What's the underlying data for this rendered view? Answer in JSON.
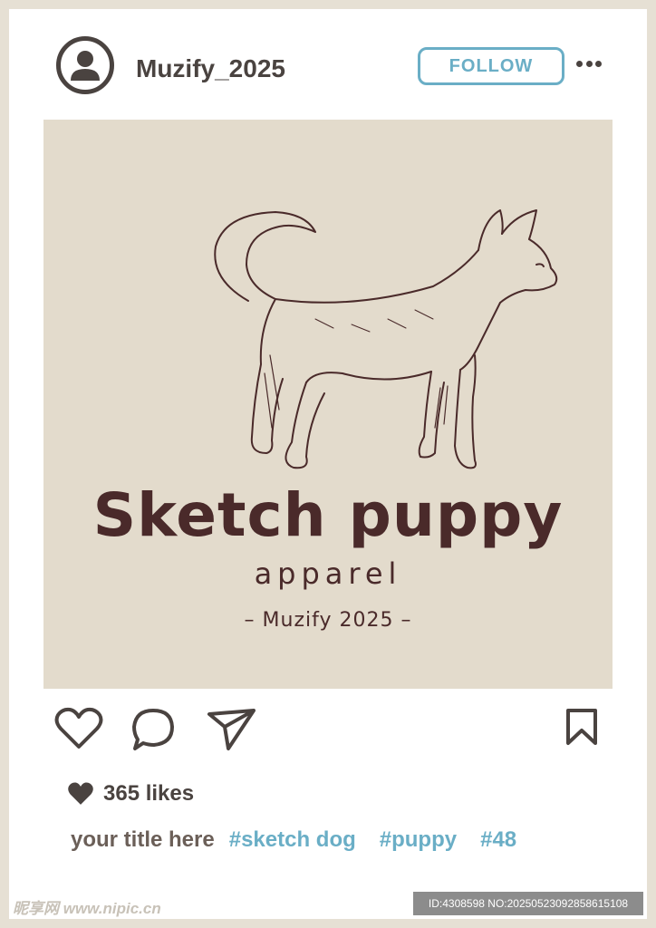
{
  "post": {
    "username": "Muzify_2025",
    "follow_label": "FOLLOW",
    "image": {
      "brand_title": "Sketch puppy",
      "brand_subtitle": "apparel",
      "brand_credit": "– Muzify 2025 –"
    },
    "likes": "365 likes",
    "caption_title": "your title here",
    "hashtags": [
      "#sketch dog",
      "#puppy",
      "#48"
    ]
  },
  "watermark": {
    "site": "昵享网 www.nipic.cn",
    "id_text": "ID:4308598 NO:20250523092858615108"
  },
  "colors": {
    "frame": "#e6e0d4",
    "image_bg": "#e3dbcc",
    "accent": "#6aaec6",
    "ink": "#4a4340",
    "brand_ink": "#4a2a2a"
  },
  "icons": [
    "user-icon",
    "more-icon",
    "heart-icon",
    "comment-icon",
    "share-icon",
    "bookmark-icon"
  ]
}
